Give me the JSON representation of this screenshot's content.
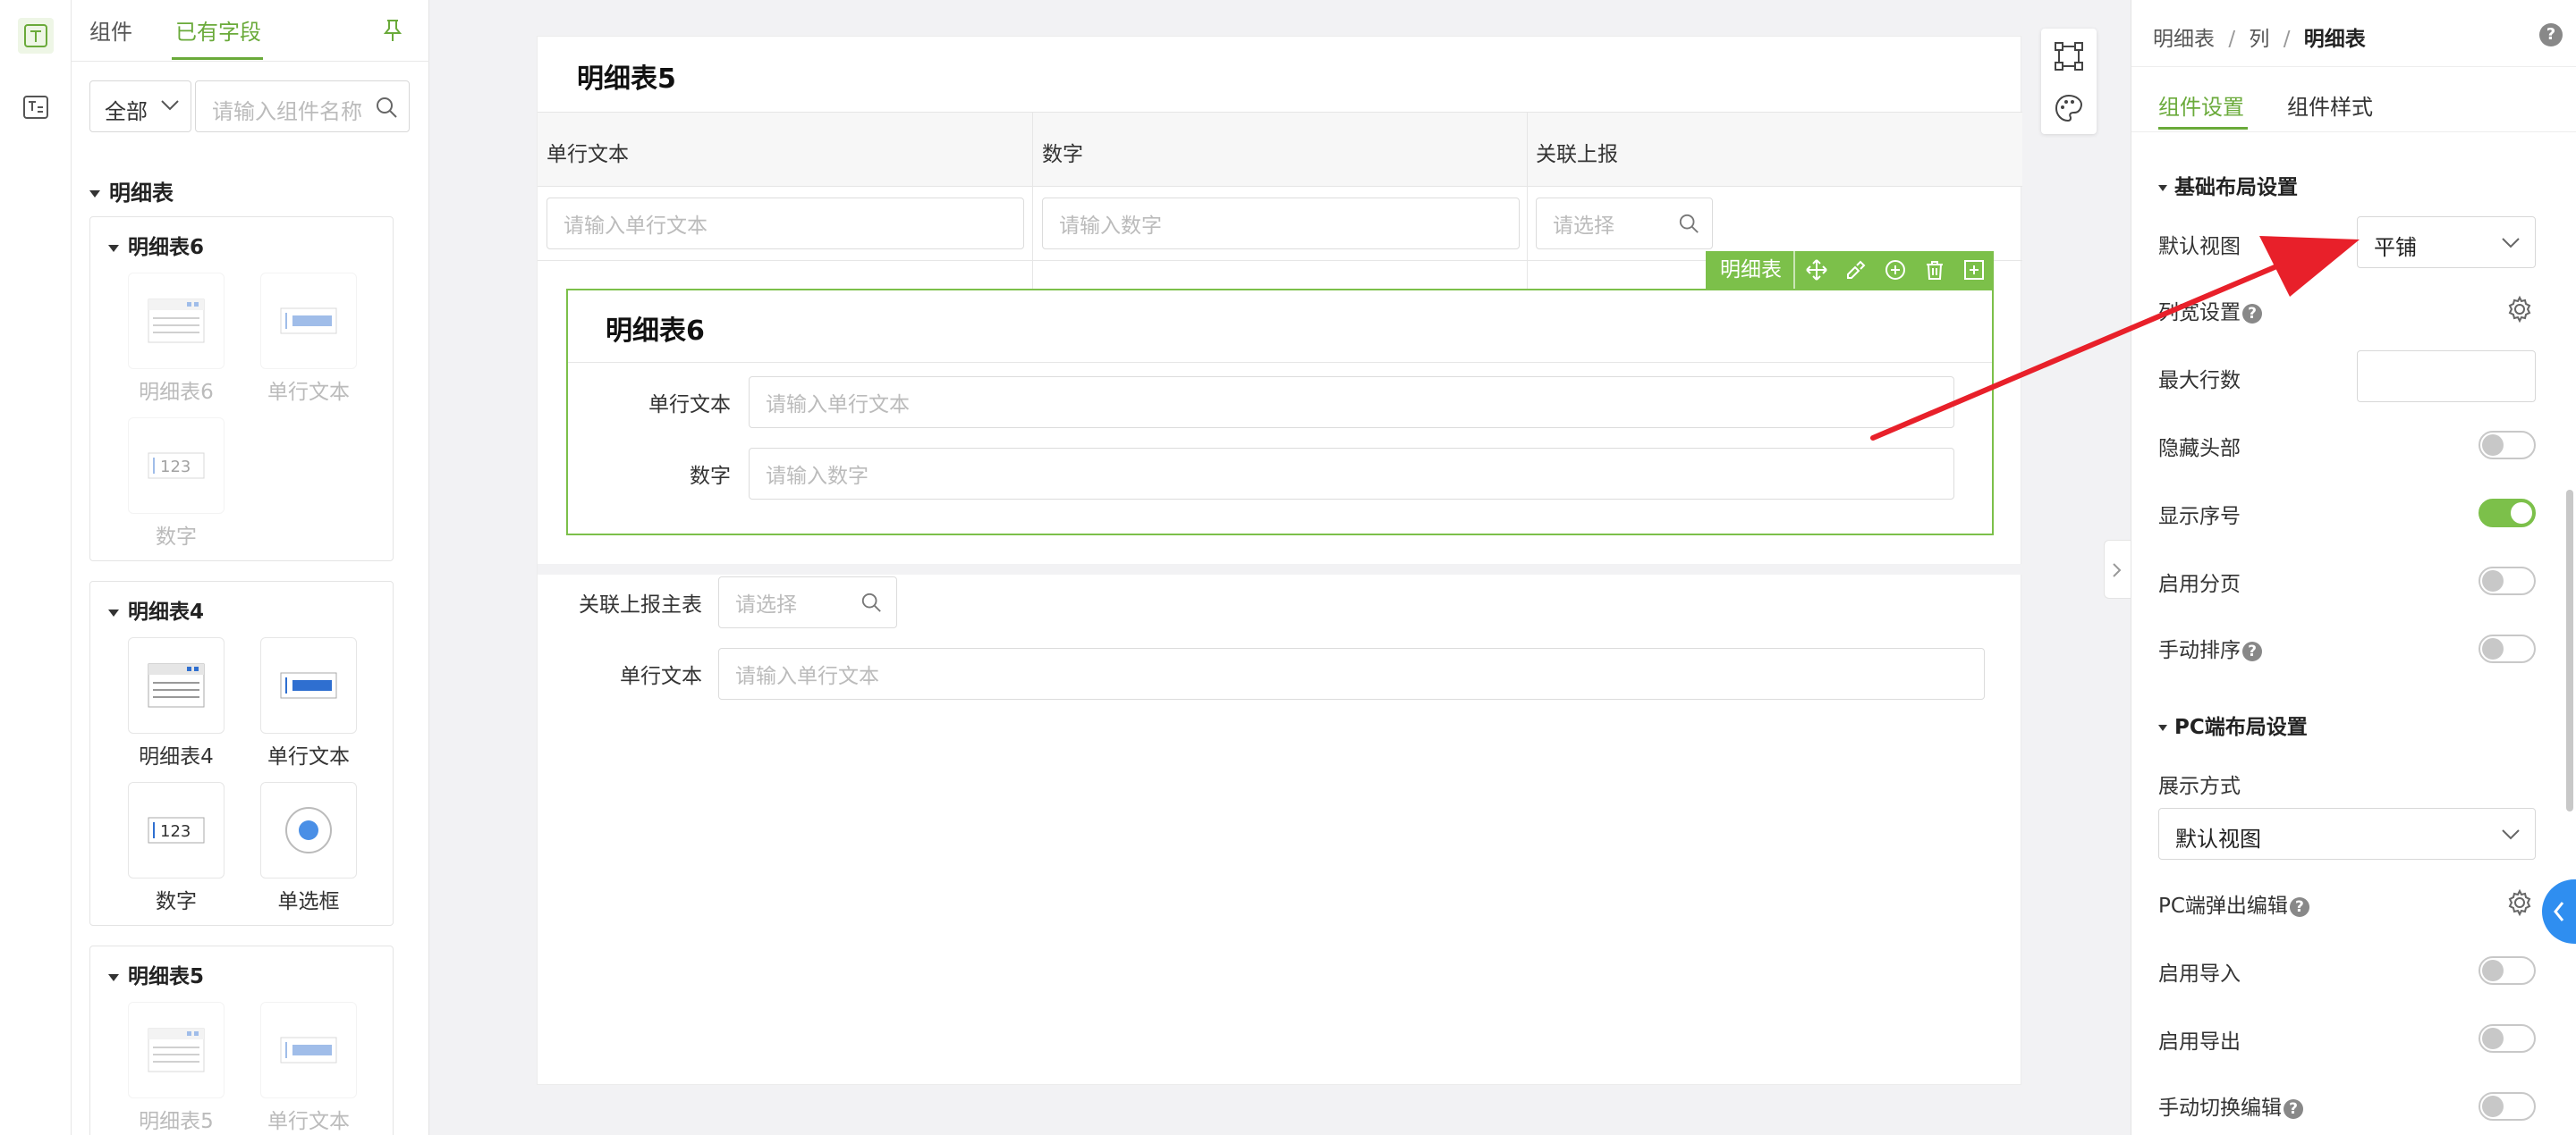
{
  "left_panel": {
    "tabs": [
      "组件",
      "已有字段"
    ],
    "filter": {
      "selected": "全部",
      "search_placeholder": "请输入组件名称"
    },
    "section_title": "明细表",
    "groups": [
      {
        "title": "明细表6",
        "items": [
          "明细表6",
          "单行文本",
          "数字"
        ],
        "disabled": true
      },
      {
        "title": "明细表4",
        "items": [
          "明细表4",
          "单行文本",
          "数字",
          "单选框"
        ],
        "disabled": false
      },
      {
        "title": "明细表5",
        "items": [
          "明细表5",
          "单行文本"
        ],
        "disabled": true
      }
    ]
  },
  "canvas": {
    "table5": {
      "title": "明细表5",
      "columns": [
        "单行文本",
        "数字",
        "关联上报"
      ],
      "placeholders": [
        "请输入单行文本",
        "请输入数字",
        "请选择"
      ]
    },
    "badge_label": "明细表",
    "table6": {
      "title": "明细表6",
      "fields": [
        {
          "label": "单行文本",
          "placeholder": "请输入单行文本"
        },
        {
          "label": "数字",
          "placeholder": "请输入数字"
        }
      ]
    },
    "form_fields": [
      {
        "label": "关联上报主表",
        "placeholder": "请选择"
      },
      {
        "label": "单行文本",
        "placeholder": "请输入单行文本"
      }
    ]
  },
  "right_panel": {
    "breadcrumb": [
      "明细表",
      "列",
      "明细表"
    ],
    "tabs": [
      "组件设置",
      "组件样式"
    ],
    "basic_section": "基础布局设置",
    "default_view_label": "默认视图",
    "default_view_value": "平铺",
    "column_settings_label": "列宽设置",
    "max_rows_label": "最大行数",
    "toggles_basic": [
      {
        "label": "隐藏头部",
        "on": false
      },
      {
        "label": "显示序号",
        "on": true
      },
      {
        "label": "启用分页",
        "on": false
      },
      {
        "label": "手动排序",
        "on": false,
        "help": true
      }
    ],
    "pc_section": "PC端布局设置",
    "display_mode_label": "展示方式",
    "display_mode_value": "默认视图",
    "pc_popup_label": "PC端弹出编辑",
    "toggles_pc": [
      {
        "label": "启用导入",
        "on": false
      },
      {
        "label": "启用导出",
        "on": false
      },
      {
        "label": "手动切换编辑",
        "on": false,
        "help": true
      }
    ]
  },
  "colors": {
    "accent": "#7cc04a",
    "text_accent": "#6aaa3a",
    "arrow": "#e8202a",
    "floating_button": "#2f8ef0"
  },
  "icons": [
    "text-field-icon",
    "text-list-icon",
    "pin-icon",
    "search-icon",
    "chevron-down-icon",
    "move-icon",
    "brush-icon",
    "plus-circle-icon",
    "trash-icon",
    "add-square-icon",
    "crop-frame-icon",
    "palette-icon",
    "chevron-right-icon",
    "gear-icon",
    "help-icon",
    "chevron-left-icon"
  ]
}
